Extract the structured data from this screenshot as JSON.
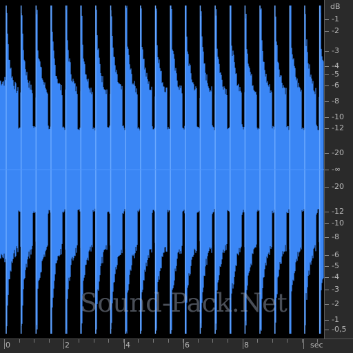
{
  "colors": {
    "waveform": "#3a86f5",
    "waveform_peak": "#6aa9ff",
    "background": "#000000",
    "ruler_bg": "#2a2a2a",
    "ruler_text": "#b8b8b8"
  },
  "db_ruler": {
    "unit": "dB",
    "labels": [
      "-1",
      "-2",
      "-3",
      "-4",
      "-5",
      "-6",
      "-8",
      "-10",
      "-12",
      "-20",
      "-∞",
      "-20",
      "-12",
      "-10",
      "-8",
      "-6",
      "-5",
      "-4",
      "-3",
      "-2",
      "-1",
      "-0,5"
    ]
  },
  "time_ruler": {
    "unit": "sec",
    "labels": [
      "0",
      "2",
      "4",
      "6",
      "8"
    ]
  },
  "watermark": "Sound-Pack.Net"
}
